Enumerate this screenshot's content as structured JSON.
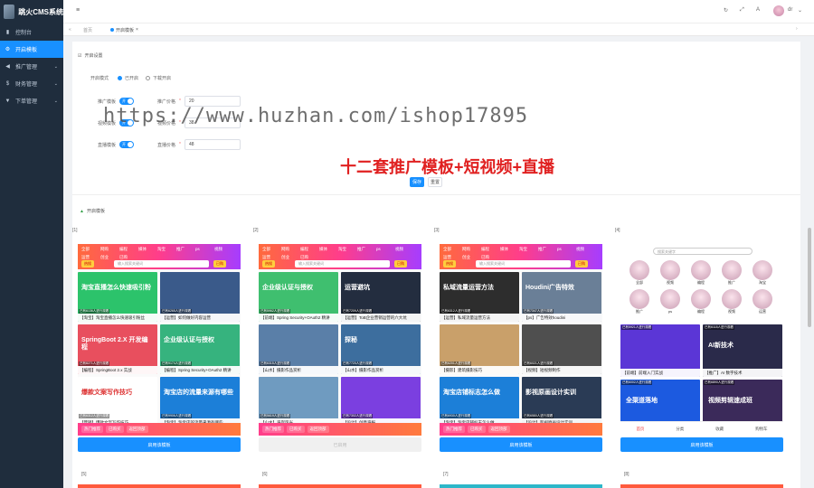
{
  "app": {
    "title": "跳火CMS系统"
  },
  "sidebar": {
    "items": [
      {
        "label": "控制台",
        "icon": "dashboard-icon"
      },
      {
        "label": "开启模板",
        "icon": "gear-icon"
      },
      {
        "label": "推广管理",
        "icon": "megaphone-icon"
      },
      {
        "label": "财务管理",
        "icon": "money-icon"
      },
      {
        "label": "下单管理",
        "icon": "filter-icon"
      }
    ]
  },
  "navbar": {
    "user": "dr"
  },
  "tabs": [
    {
      "label": "首页"
    },
    {
      "label": "开启模板"
    }
  ],
  "settings": {
    "section_title": "开启设置",
    "mode_label": "开启模式",
    "mode_opt1": "已开启",
    "mode_opt2": "下载开启",
    "switch_on": "开",
    "rows": [
      {
        "label": "推广模板",
        "price_label": "推广价格",
        "price": "20"
      },
      {
        "label": "视频模板",
        "price_label": "视频价格",
        "price": "38"
      },
      {
        "label": "直播模板",
        "price_label": "直播价格",
        "price": "48"
      }
    ],
    "save": "保存",
    "reset": "重置"
  },
  "watermark": "https://www.huzhan.com/ishop17895",
  "promo": "十二套推广模板+短视频+直播",
  "templates_title": "开启模板",
  "templates": [
    {
      "name": "[1]",
      "btn": "启用该模板",
      "cats": [
        "全部",
        "网购",
        "编程",
        "媒体",
        "淘宝",
        "推广",
        "ps",
        "视频",
        "运营",
        "创业",
        "已购"
      ],
      "search": "输入搜索关键词",
      "hot_btn": "热搜",
      "buy_btn": "已购",
      "videos": [
        {
          "c": "已有6136人进行观看",
          "t": "【淘宝】淘宝直播怎么快速吸引粉丝",
          "bg": "#2cc36b",
          "ov": "淘宝直播怎么快速吸引粉"
        },
        {
          "c": "已有6265人进行观看",
          "t": "【运营】如何做好内容运营",
          "bg": "#3a5a8a",
          "ov": ""
        },
        {
          "c": "已有8271人进行观看",
          "t": "【编程】SpringBoot 2.x 实战",
          "bg": "#e84f5e",
          "ov": "SpringBoot 2.X 开发编程"
        },
        {
          "c": "已有9174人进行观看",
          "t": "【编程】Spring Security+OAuth2 精讲",
          "bg": "#36b37e",
          "ov": "企业级认证与授权"
        },
        {
          "c": "已有6312人进行观看",
          "t": "【营销】爆款文案写作技巧",
          "bg": "#ffffff",
          "ov": "爆款文案写作技巧"
        },
        {
          "c": "已有9906人进行观看",
          "t": "【淘宝】淘宝店的流量来源有哪些",
          "bg": "#1c7fd8",
          "ov": "淘宝店的流量来源有哪些"
        }
      ],
      "f1": "热门推荐",
      "f2": "已购买",
      "f3": "返回顶部"
    },
    {
      "name": "[2]",
      "btn": "已启用",
      "cats": [
        "全部",
        "网购",
        "编程",
        "媒体",
        "淘宝",
        "推广",
        "ps",
        "视频",
        "运营",
        "创业",
        "已购"
      ],
      "search": "输入搜索关键词",
      "hot_btn": "热搜",
      "buy_btn": "已购",
      "videos": [
        {
          "c": "已有5962人进行观看",
          "t": "【前端】Spring Security+OAuth2 精讲",
          "bg": "#3fbf6f",
          "ov": "企业级认证与授权"
        },
        {
          "c": "已有7209人进行观看",
          "t": "【运营】ToB企业营销运营的六大坑",
          "bg": "#232d3f",
          "ov": "运营避坑"
        },
        {
          "c": "已有6315人进行观看",
          "t": "【山水】摄影作品赏析",
          "bg": "#5a7fa8",
          "ov": ""
        },
        {
          "c": "已有7720人进行观看",
          "t": "【山水】摄影作品赏析",
          "bg": "#3d6e9e",
          "ov": "探秘"
        },
        {
          "c": "已有5619人进行观看",
          "t": "【山水】海岸风光",
          "bg": "#6f9bc0",
          "ov": ""
        },
        {
          "c": "已有7302人进行观看",
          "t": "【设计】创意海报",
          "bg": "#7b3fe0",
          "ov": ""
        }
      ],
      "f1": "热门推荐",
      "f2": "已购买",
      "f3": "返回顶部"
    },
    {
      "name": "[3]",
      "btn": "启用该模板",
      "cats": [
        "全部",
        "网购",
        "编程",
        "媒体",
        "淘宝",
        "推广",
        "ps",
        "视频",
        "运营",
        "创业",
        "已购"
      ],
      "search": "输入搜索关键词",
      "hot_btn": "热搜",
      "buy_btn": "已购",
      "videos": [
        {
          "c": "已有6312人进行观看",
          "t": "【运营】私域流量运营方法",
          "bg": "#2d2d2d",
          "ov": "私域流量运营方法"
        },
        {
          "c": "已有7347人进行观看",
          "t": "【ps】广告特效houdini",
          "bg": "#6a7f97",
          "ov": "Houdini广告特效"
        },
        {
          "c": "已有6201人进行观看",
          "t": "【摄影】建筑摄影技巧",
          "bg": "#c9a06a",
          "ov": ""
        },
        {
          "c": "已有6021人进行观看",
          "t": "【视频】短视频制作",
          "bg": "#4f4f4f",
          "ov": ""
        },
        {
          "c": "已有6930人进行观看",
          "t": "【淘宝】淘宝店铺标志怎么做",
          "bg": "#1c7fd8",
          "ov": "淘宝店铺标志怎么做"
        },
        {
          "c": "已有6580人进行观看",
          "t": "【设计】影视原画设计实训",
          "bg": "#2a3b55",
          "ov": "影视原画设计实训"
        }
      ],
      "f1": "热门推荐",
      "f2": "已购买",
      "f3": "返回顶部"
    },
    {
      "name": "[4]",
      "btn": "启用该模板",
      "search": "搜索关键字",
      "bubbles": [
        "全部",
        "视频",
        "编程",
        "推广",
        "淘宝",
        "推广",
        "ps",
        "编程",
        "视频",
        "运营"
      ],
      "videos": [
        {
          "c": "已有5921人进行观看",
          "t": "【前端】前端入门实战",
          "bg": "#5b36d6",
          "ov": ""
        },
        {
          "c": "已有6118人进行观看",
          "t": "【推广】AI 数字技术",
          "bg": "#2a2a4a",
          "ov": "AI新技术"
        },
        {
          "c": "已有6002人进行观看",
          "t": "【运营】全渠道落地",
          "bg": "#1c5ae0",
          "ov": "全渠道落地"
        },
        {
          "c": "已有6890人进行观看",
          "t": "【视频】视频剪辑速成班",
          "bg": "#3b2a5a",
          "ov": "视频剪辑速成班"
        }
      ],
      "f1": "首页",
      "f2": "分类",
      "f3": "收藏",
      "f4": "购物车"
    }
  ],
  "templates_row2": [
    {
      "name": "[5]"
    },
    {
      "name": "[6]"
    },
    {
      "name": "[7]"
    },
    {
      "name": "[8]"
    }
  ]
}
